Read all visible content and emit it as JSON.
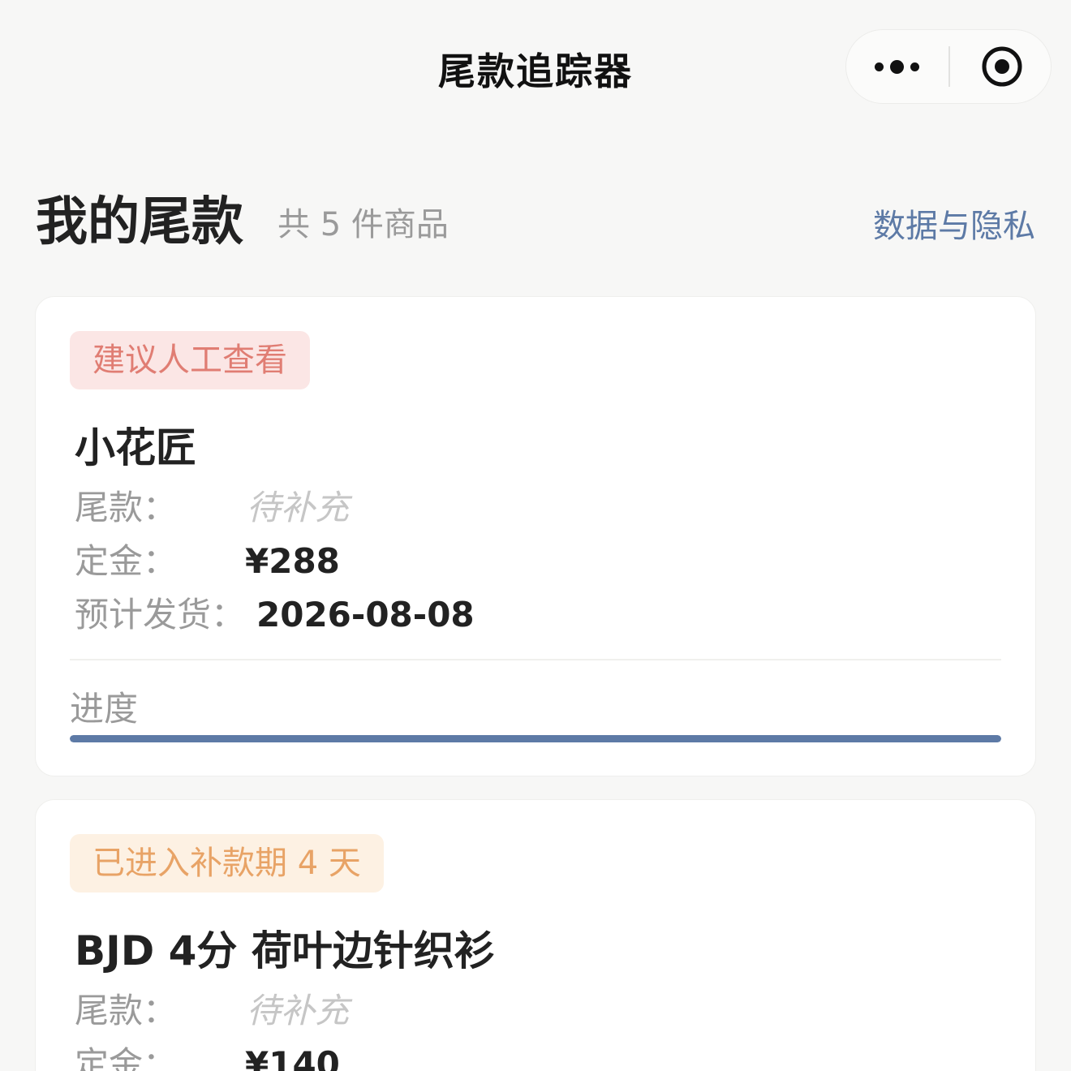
{
  "nav": {
    "title": "尾款追踪器",
    "more_icon": "more-dots-icon",
    "close_icon": "target-circle-icon"
  },
  "header": {
    "title": "我的尾款",
    "count": "共 5 件商品",
    "privacy_link": "数据与隐私"
  },
  "colors": {
    "accent": "#5d7aa6",
    "badge_red_bg": "#fbe6e5",
    "badge_red_text": "#e07d73",
    "badge_orange_bg": "#fdf1e3",
    "badge_orange_text": "#e8a366"
  },
  "items": [
    {
      "badge": "建议人工查看",
      "name": "小花匠",
      "balance_label": "尾款：",
      "balance_value": "待补充",
      "deposit_label": "定金：",
      "deposit_value": "¥288",
      "ship_label": "预计发货：",
      "ship_value": "2026-08-08",
      "progress_label": "进度",
      "progress": 1.0
    },
    {
      "badge": "已进入补款期 4 天",
      "name": "BJD 4分 荷叶边针织衫",
      "balance_label": "尾款：",
      "balance_value": "待补充",
      "deposit_label": "定金：",
      "deposit_value": "¥140"
    }
  ]
}
